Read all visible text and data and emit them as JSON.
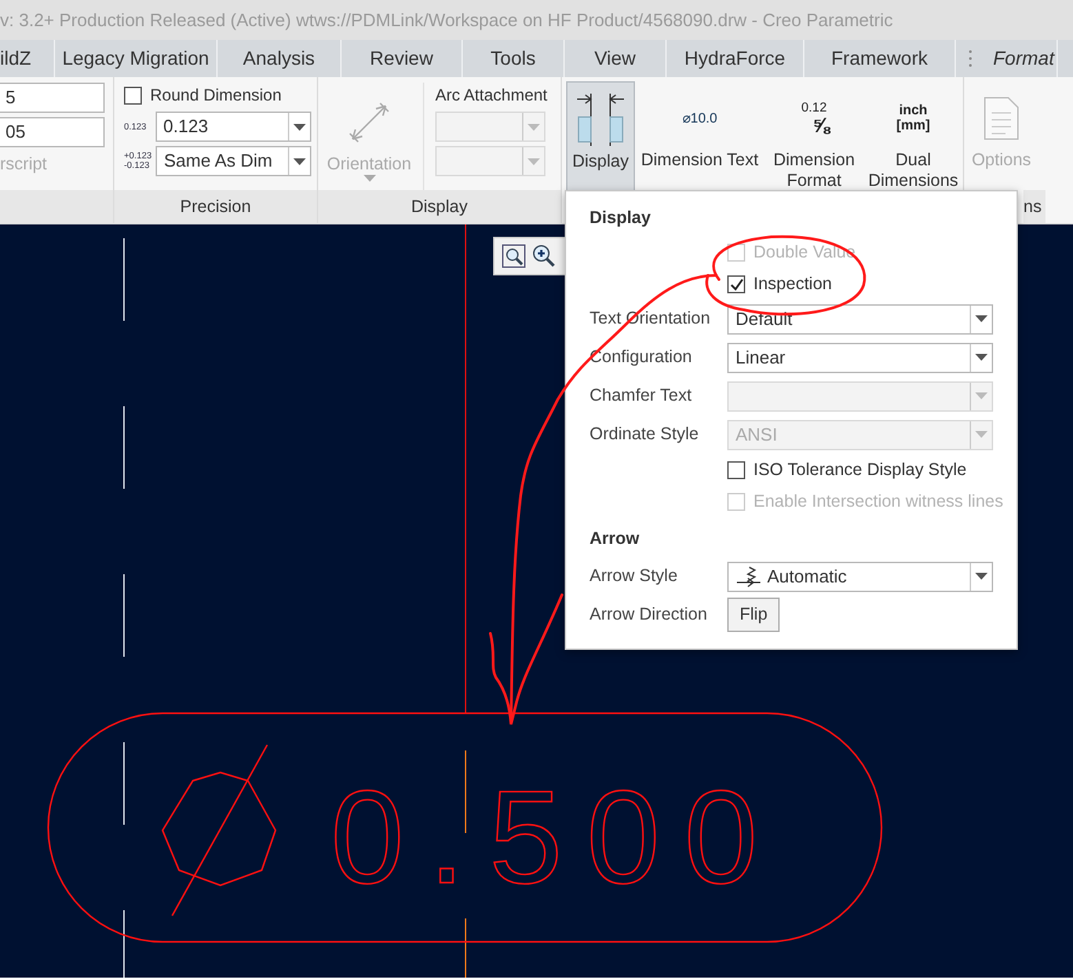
{
  "window": {
    "title": "v: 3.2+ Production Released  (Active) wtws://PDMLink/Workspace on HF Product/4568090.drw - Creo Parametric"
  },
  "tabs": [
    {
      "label": "ildZ",
      "selected": false
    },
    {
      "label": "Legacy Migration",
      "selected": false
    },
    {
      "label": "Analysis",
      "selected": false
    },
    {
      "label": "Review",
      "selected": false
    },
    {
      "label": "Tools",
      "selected": false
    },
    {
      "label": "View",
      "selected": false
    },
    {
      "label": "HydraForce",
      "selected": false
    },
    {
      "label": "Framework",
      "selected": false
    },
    {
      "label": "Format",
      "selected": true
    }
  ],
  "ribbon": {
    "partial_group": {
      "fields": [
        "5",
        "05"
      ],
      "label": "rscript"
    },
    "precision": {
      "label": "Precision",
      "round_dimension": {
        "label": "Round Dimension",
        "checked": false
      },
      "decimals": {
        "icon_text": "0.123",
        "value": "0.123"
      },
      "tolerance_decimals": {
        "icon_text": [
          "+0.123",
          "-0.123"
        ],
        "value": "Same As Dim"
      }
    },
    "display_group": {
      "label": "Display",
      "orientation": {
        "label": "Orientation",
        "disabled": true
      },
      "arc_attachment": {
        "label": "Arc Attachment",
        "disabled": true
      }
    },
    "buttons": [
      {
        "kind": "display",
        "label": "Display",
        "pressed": true,
        "disabled": false
      },
      {
        "kind": "dimension_text",
        "label": "Dimension Text",
        "icon_text": [
          "⌀10.0"
        ],
        "pressed": false,
        "disabled": false
      },
      {
        "kind": "dimension_format",
        "label": "Dimension Format",
        "icon_text": [
          "0.12",
          "⅝"
        ],
        "pressed": false,
        "disabled": false
      },
      {
        "kind": "dual_dimensions",
        "label": "Dual Dimensions",
        "icon_text": [
          "inch",
          "[mm]"
        ],
        "pressed": false,
        "disabled": false
      },
      {
        "kind": "options",
        "label": "Options",
        "pressed": false,
        "disabled": true
      }
    ],
    "cut_group_label": "ns"
  },
  "popup": {
    "sections": [
      {
        "title": "Display",
        "rows": [
          {
            "kind": "checkbox",
            "label": "Double Value",
            "checked": false,
            "disabled": true
          },
          {
            "kind": "checkbox",
            "label": "Inspection",
            "checked": true,
            "disabled": false
          },
          {
            "kind": "select",
            "label": "Text Orientation",
            "value": "Default",
            "disabled": false
          },
          {
            "kind": "select",
            "label": "Configuration",
            "value": "Linear",
            "disabled": false
          },
          {
            "kind": "select",
            "label": "Chamfer Text",
            "disabled": true
          },
          {
            "kind": "select",
            "label": "Ordinate Style",
            "value": "ANSI",
            "disabled": true
          },
          {
            "kind": "checkbox",
            "label": "ISO Tolerance Display Style",
            "checked": false,
            "disabled": false
          },
          {
            "kind": "checkbox",
            "label": "Enable Intersection witness lines",
            "checked": false,
            "disabled": true
          }
        ]
      },
      {
        "title": "Arrow",
        "rows": [
          {
            "kind": "select",
            "label": "Arrow Style",
            "value": "Automatic",
            "icon": true,
            "disabled": false
          },
          {
            "kind": "button",
            "label": "Arrow Direction",
            "button": "Flip"
          }
        ]
      }
    ]
  },
  "drawing": {
    "dimension": {
      "value": "0.500"
    }
  }
}
